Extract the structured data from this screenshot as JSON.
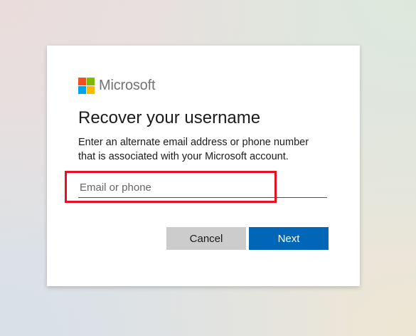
{
  "brand": {
    "name": "Microsoft",
    "logo_colors": [
      "#f25022",
      "#7fba00",
      "#00a4ef",
      "#ffb900"
    ]
  },
  "page": {
    "title": "Recover your username",
    "description": "Enter an alternate email address or phone number that is associated with your Microsoft account."
  },
  "form": {
    "email_placeholder": "Email or phone",
    "email_value": ""
  },
  "buttons": {
    "cancel_label": "Cancel",
    "next_label": "Next"
  },
  "colors": {
    "accent": "#0067b8",
    "highlight": "#e81123",
    "cancel_bg": "#cccccc"
  }
}
